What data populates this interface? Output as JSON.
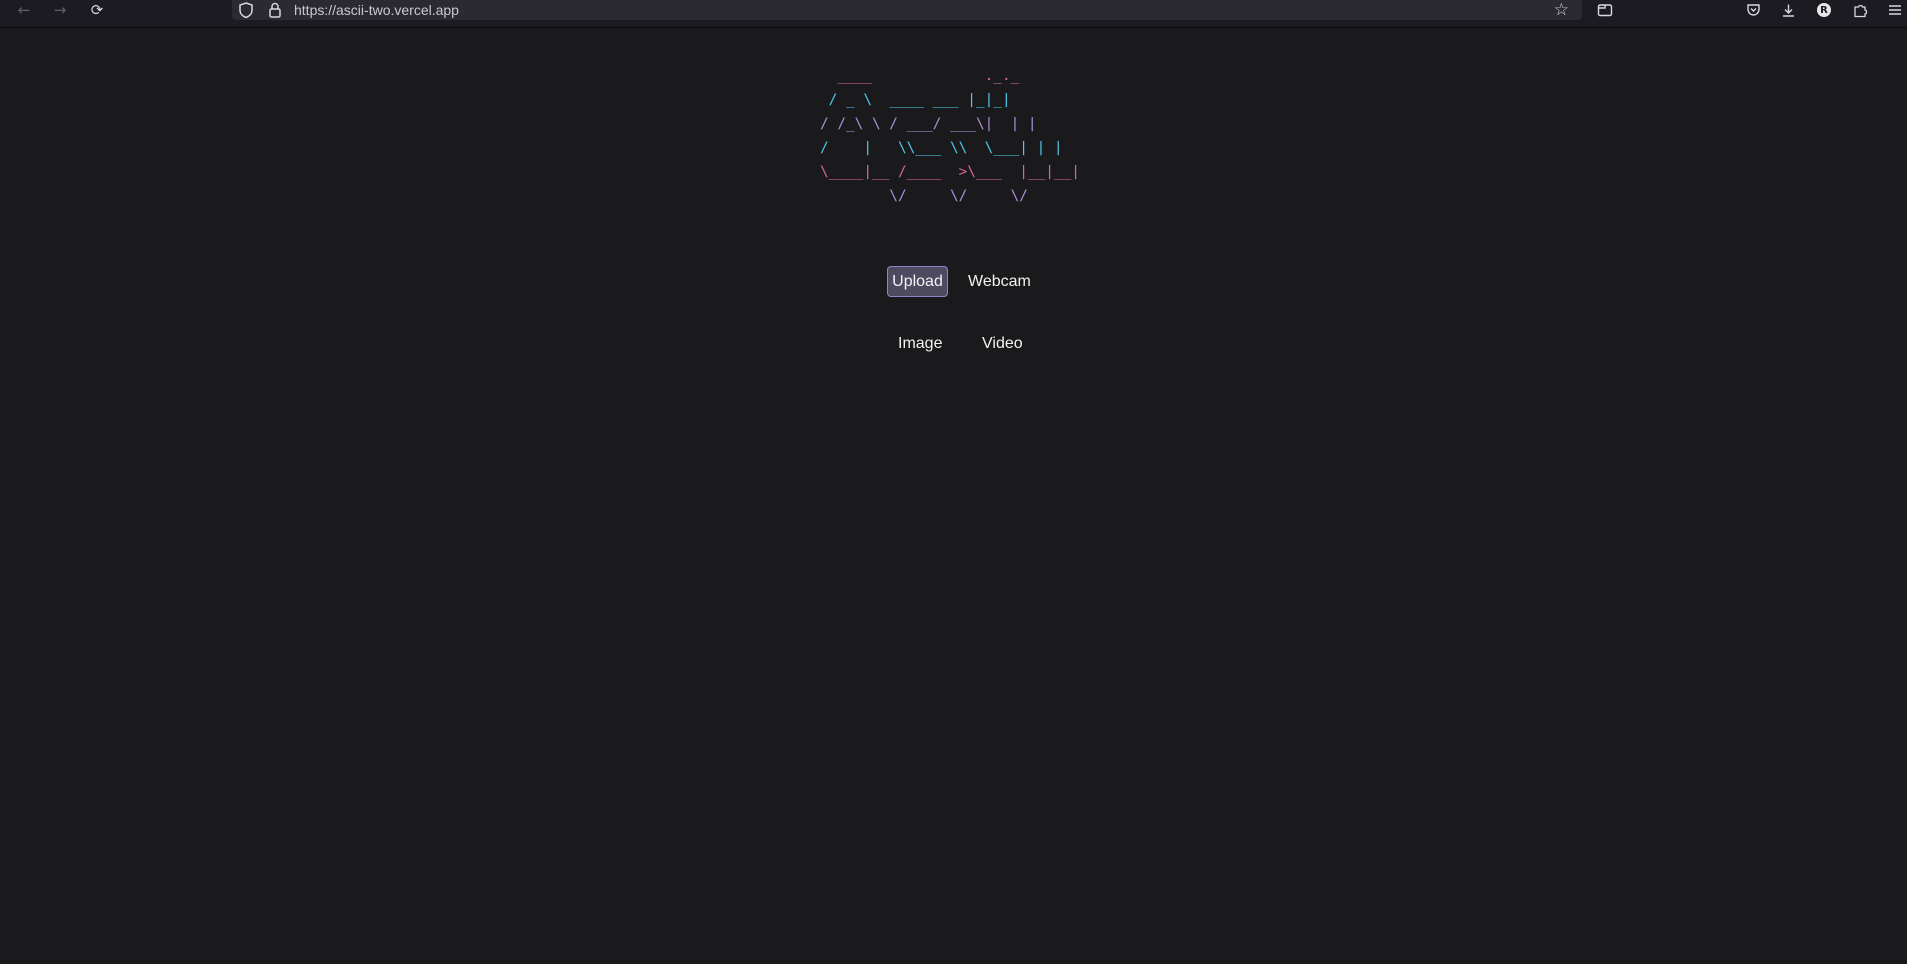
{
  "browser": {
    "url": "https://ascii-two.vercel.app",
    "icons": {
      "back": "arrow-left-icon",
      "forward": "arrow-right-icon",
      "reload": "reload-icon",
      "shield": "shield-icon",
      "lock": "lock-icon",
      "bookmark": "star-icon",
      "containers": "folder-icon",
      "pocket": "pocket-icon",
      "downloads": "download-icon",
      "account": "avatar",
      "extensions": "puzzle-icon",
      "menu": "hamburger-icon"
    },
    "account_initial": "R"
  },
  "logo": {
    "lines": [
      "  ____             ._._ ",
      " / _ \\  ____ ___ |_|_|",
      "/ /_\\ \\ / ___/ ___\\|  | |",
      "/    |   \\\\___ \\\\  \\___| | |",
      "\\____|__ /____  >\\___  |__|__|",
      "        \\/     \\/     \\/      "
    ],
    "colors": {
      "pink": "#d9669b",
      "cyan": "#4fc7e8",
      "violet": "#a98fd8"
    }
  },
  "source_tabs": {
    "upload": "Upload",
    "webcam": "Webcam",
    "active": "upload"
  },
  "media_tabs": {
    "image": "Image",
    "video": "Video"
  },
  "theme": {
    "background": "#1a1a1d",
    "active_button_bg": "#4e4a60",
    "active_button_border": "#8f84c8",
    "text": "#f2f2f2"
  }
}
